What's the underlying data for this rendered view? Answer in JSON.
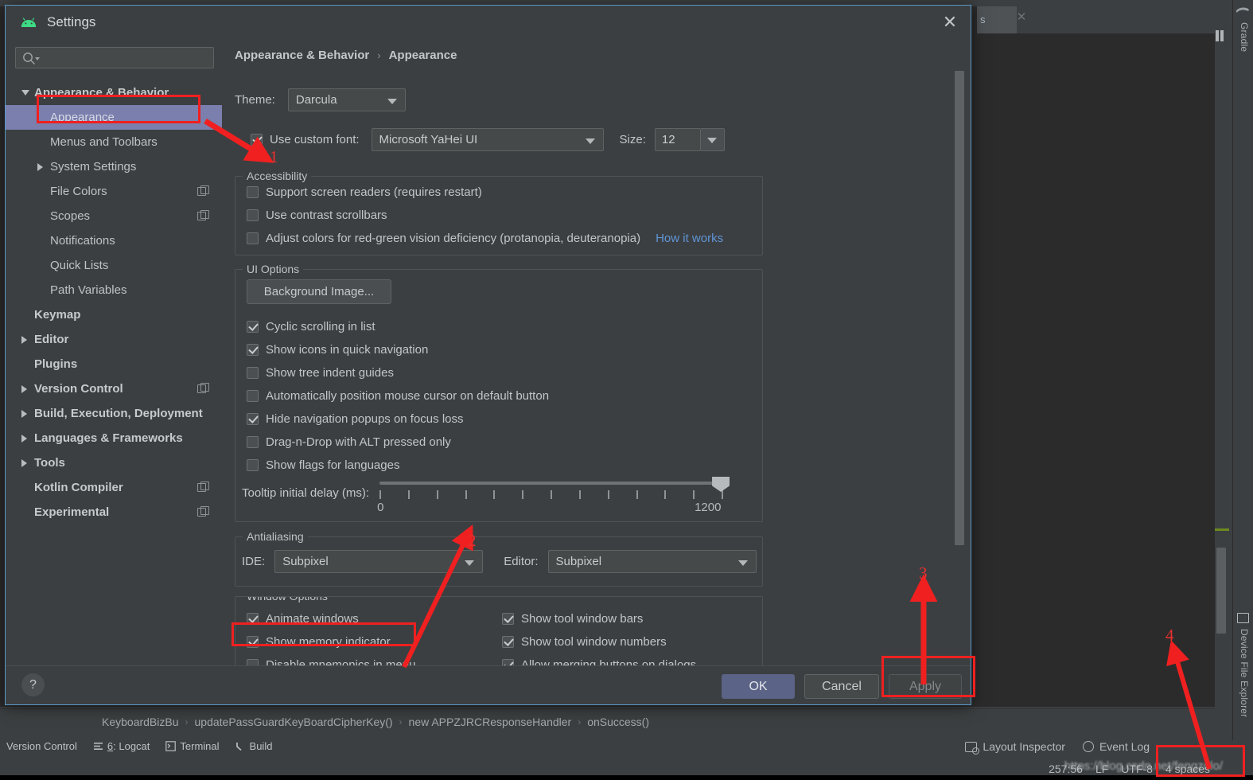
{
  "window": {
    "tab_label": "s",
    "close_icon": "close-icon"
  },
  "right_toolbar": {
    "gradle": "Gradle",
    "device_file_explorer": "Device File Explorer"
  },
  "dialog": {
    "title": "Settings",
    "close_label": "✕",
    "search": {
      "value": "",
      "placeholder": ""
    },
    "breadcrumb": {
      "parent": "Appearance & Behavior",
      "separator": "›",
      "current": "Appearance"
    },
    "sidebar": [
      {
        "label": "Appearance & Behavior",
        "level": 0,
        "bold": true,
        "arrow": "down",
        "selected": false,
        "copy": false
      },
      {
        "label": "Appearance",
        "level": 1,
        "bold": false,
        "arrow": "none",
        "selected": true,
        "copy": false
      },
      {
        "label": "Menus and Toolbars",
        "level": 1,
        "bold": false,
        "arrow": "none",
        "selected": false,
        "copy": false
      },
      {
        "label": "System Settings",
        "level": 1,
        "bold": false,
        "arrow": "right",
        "selected": false,
        "copy": false
      },
      {
        "label": "File Colors",
        "level": 1,
        "bold": false,
        "arrow": "none",
        "selected": false,
        "copy": true
      },
      {
        "label": "Scopes",
        "level": 1,
        "bold": false,
        "arrow": "none",
        "selected": false,
        "copy": true
      },
      {
        "label": "Notifications",
        "level": 1,
        "bold": false,
        "arrow": "none",
        "selected": false,
        "copy": false
      },
      {
        "label": "Quick Lists",
        "level": 1,
        "bold": false,
        "arrow": "none",
        "selected": false,
        "copy": false
      },
      {
        "label": "Path Variables",
        "level": 1,
        "bold": false,
        "arrow": "none",
        "selected": false,
        "copy": false
      },
      {
        "label": "Keymap",
        "level": 0,
        "bold": true,
        "arrow": "none",
        "selected": false,
        "copy": false
      },
      {
        "label": "Editor",
        "level": 0,
        "bold": true,
        "arrow": "right",
        "selected": false,
        "copy": false
      },
      {
        "label": "Plugins",
        "level": 0,
        "bold": true,
        "arrow": "none",
        "selected": false,
        "copy": false
      },
      {
        "label": "Version Control",
        "level": 0,
        "bold": true,
        "arrow": "right",
        "selected": false,
        "copy": true
      },
      {
        "label": "Build, Execution, Deployment",
        "level": 0,
        "bold": true,
        "arrow": "right",
        "selected": false,
        "copy": false
      },
      {
        "label": "Languages & Frameworks",
        "level": 0,
        "bold": true,
        "arrow": "right",
        "selected": false,
        "copy": false
      },
      {
        "label": "Tools",
        "level": 0,
        "bold": true,
        "arrow": "right",
        "selected": false,
        "copy": false
      },
      {
        "label": "Kotlin Compiler",
        "level": 0,
        "bold": true,
        "arrow": "none",
        "selected": false,
        "copy": true
      },
      {
        "label": "Experimental",
        "level": 0,
        "bold": true,
        "arrow": "none",
        "selected": false,
        "copy": true
      }
    ],
    "theme": {
      "label": "Theme:",
      "value": "Darcula"
    },
    "font": {
      "checkbox_label": "Use custom font:",
      "checked": true,
      "value": "Microsoft YaHei UI",
      "size_label": "Size:",
      "size_value": "12"
    },
    "accessibility": {
      "title": "Accessibility",
      "items": [
        {
          "label": "Support screen readers (requires restart)",
          "checked": false
        },
        {
          "label": "Use contrast scrollbars",
          "checked": false
        },
        {
          "label": "Adjust colors for red-green vision deficiency (protanopia, deuteranopia)",
          "checked": false
        }
      ],
      "link": "How it works"
    },
    "ui_options": {
      "title": "UI Options",
      "background_button": "Background Image...",
      "items": [
        {
          "label": "Cyclic scrolling in list",
          "checked": true
        },
        {
          "label": "Show icons in quick navigation",
          "checked": true
        },
        {
          "label": "Show tree indent guides",
          "checked": false
        },
        {
          "label": "Automatically position mouse cursor on default button",
          "checked": false
        },
        {
          "label": "Hide navigation popups on focus loss",
          "checked": true
        },
        {
          "label": "Drag-n-Drop with ALT pressed only",
          "checked": false
        },
        {
          "label": "Show flags for languages",
          "checked": false
        }
      ],
      "tooltip_delay": {
        "label": "Tooltip initial delay (ms):",
        "min": "0",
        "max": "1200",
        "value": 1200,
        "ticks": 13
      }
    },
    "antialiasing": {
      "title": "Antialiasing",
      "ide_label": "IDE:",
      "ide_value": "Subpixel",
      "editor_label": "Editor:",
      "editor_value": "Subpixel"
    },
    "window_options": {
      "title": "Window Options",
      "left": [
        {
          "label": "Animate windows",
          "checked": true
        },
        {
          "label": "Show memory indicator",
          "checked": true
        },
        {
          "label": "Disable mnemonics in menu",
          "checked": false
        }
      ],
      "right": [
        {
          "label": "Show tool window bars",
          "checked": true
        },
        {
          "label": "Show tool window numbers",
          "checked": true
        },
        {
          "label": "Allow merging buttons on dialogs",
          "checked": true
        }
      ]
    },
    "footer": {
      "help": "?",
      "ok": "OK",
      "cancel": "Cancel",
      "apply": "Apply"
    }
  },
  "breadcrumb_bar": {
    "items": [
      "KeyboardBizBu",
      "updatePassGuardKeyBoardCipherKey()",
      "new APPZJRCResponseHandler",
      "onSuccess()"
    ],
    "separator": "›"
  },
  "toolwindow_bar": [
    {
      "label": "Version Control",
      "icon": ""
    },
    {
      "label": "Logcat",
      "num": "6",
      "icon": "logcat-icon"
    },
    {
      "label": "Terminal",
      "icon": "terminal-icon"
    },
    {
      "label": "Build",
      "icon": "build-icon"
    }
  ],
  "status_bar": {
    "layout_inspector": "Layout Inspector",
    "event_log": "Event Log",
    "position": "257:56",
    "line_sep": "LF",
    "encoding": "UTF-8",
    "indent": "4 spaces",
    "watermark": "https://blog.csdn.net/fengzolo/"
  },
  "annotations": {
    "numbers": [
      "1",
      "2",
      "3",
      "4"
    ],
    "color": "#f02020"
  }
}
